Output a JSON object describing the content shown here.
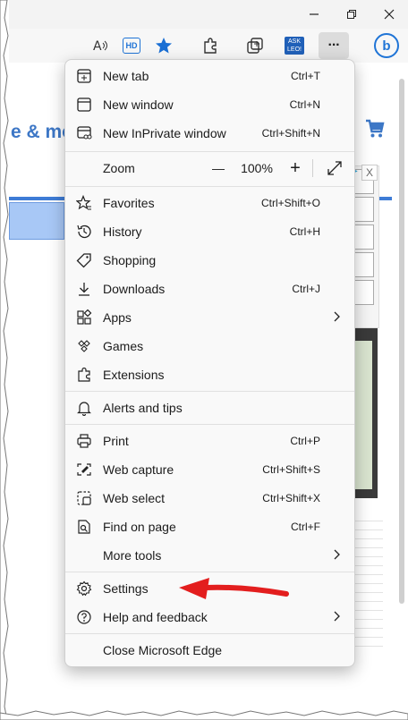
{
  "window": {
    "minimize_icon": "minimize-icon",
    "maximize_icon": "restore-icon",
    "close_icon": "close-icon"
  },
  "toolbar": {
    "read_aloud_icon": "read-aloud-icon",
    "hd_label": "HD",
    "favorites_icon": "star-icon",
    "extensions_icon": "puzzle-icon",
    "collections_icon": "collections-icon",
    "askleo_label_top": "ASK",
    "askleo_label_bottom": "LEO!",
    "more_label": "···",
    "bing_label": "b"
  },
  "page": {
    "partial_text": "e & mo"
  },
  "menu": {
    "items": [
      {
        "label": "New tab",
        "shortcut": "Ctrl+T",
        "icon": "new-tab-icon"
      },
      {
        "label": "New window",
        "shortcut": "Ctrl+N",
        "icon": "window-icon"
      },
      {
        "label": "New InPrivate window",
        "shortcut": "Ctrl+Shift+N",
        "icon": "inprivate-icon"
      },
      {
        "label": "Zoom",
        "zoom_out": "—",
        "zoom_value": "100%",
        "zoom_in": "+",
        "fullscreen_icon": "fullscreen-icon"
      },
      {
        "label": "Favorites",
        "shortcut": "Ctrl+Shift+O",
        "icon": "favorites-icon"
      },
      {
        "label": "History",
        "shortcut": "Ctrl+H",
        "icon": "history-icon"
      },
      {
        "label": "Shopping",
        "icon": "tag-icon"
      },
      {
        "label": "Downloads",
        "shortcut": "Ctrl+J",
        "icon": "download-icon"
      },
      {
        "label": "Apps",
        "icon": "apps-icon",
        "submenu": true
      },
      {
        "label": "Games",
        "icon": "games-icon"
      },
      {
        "label": "Extensions",
        "icon": "extensions-icon"
      },
      {
        "label": "Alerts and tips",
        "icon": "bell-icon"
      },
      {
        "label": "Print",
        "shortcut": "Ctrl+P",
        "icon": "printer-icon"
      },
      {
        "label": "Web capture",
        "shortcut": "Ctrl+Shift+S",
        "icon": "web-capture-icon"
      },
      {
        "label": "Web select",
        "shortcut": "Ctrl+Shift+X",
        "icon": "web-select-icon"
      },
      {
        "label": "Find on page",
        "shortcut": "Ctrl+F",
        "icon": "find-icon"
      },
      {
        "label": "More tools",
        "icon": "",
        "submenu": true
      },
      {
        "label": "Settings",
        "icon": "gear-icon"
      },
      {
        "label": "Help and feedback",
        "icon": "help-icon",
        "submenu": true
      },
      {
        "label": "Close Microsoft Edge",
        "icon": ""
      }
    ]
  },
  "ad": {
    "close_label": "X"
  },
  "colors": {
    "accent": "#3e7cd6",
    "arrow": "#e31e1e"
  }
}
